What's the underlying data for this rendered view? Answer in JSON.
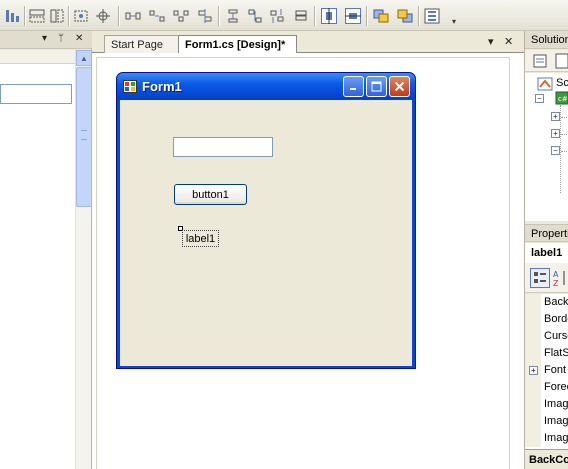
{
  "toolbar": {
    "buttons": [
      "align-to-grid-icon",
      "make-same-width-icon",
      "make-same-height-icon",
      "size-to-grid-icon",
      "center-icon",
      "horizontal-spacing-equal-icon",
      "increase-horizontal-spacing-icon",
      "decrease-horizontal-spacing-icon",
      "remove-horizontal-spacing-icon",
      "vertical-spacing-equal-icon",
      "increase-vertical-spacing-icon",
      "decrease-vertical-spacing-icon",
      "remove-vertical-spacing-icon",
      "center-horizontally-icon",
      "center-vertically-icon",
      "bring-to-front-icon",
      "send-to-back-icon",
      "tab-order-icon"
    ],
    "overflow_glyph": "▾"
  },
  "left_pane": {
    "pin_glyph": "▾",
    "autohide_glyph": "ᛘ",
    "close_glyph": "✕",
    "scroll_up_glyph": "▲"
  },
  "document_tabs": {
    "tabs": [
      {
        "label": "Start Page"
      },
      {
        "label": "Form1.cs [Design]*"
      }
    ],
    "dropdown_glyph": "▾",
    "close_glyph": "✕"
  },
  "form": {
    "title": "Form1",
    "button_label": "button1",
    "label_text": "label1",
    "textbox_value": "",
    "colors": {
      "titlebar": "#0B5AE8",
      "client": "#ECE9D8",
      "close_button": "#C33B12"
    }
  },
  "solution_explorer": {
    "title": "Solution",
    "tree": [
      {
        "text": "Sc",
        "expander": ""
      },
      {
        "text": "",
        "expander": "−"
      },
      {
        "text": "",
        "expander": "+"
      },
      {
        "text": "",
        "expander": "+"
      },
      {
        "text": "",
        "expander": "−"
      }
    ]
  },
  "properties": {
    "title": "Properti",
    "object": "label1",
    "rows": [
      {
        "name": "Backc",
        "expander": ""
      },
      {
        "name": "Borde",
        "expander": ""
      },
      {
        "name": "Curso",
        "expander": ""
      },
      {
        "name": "FlatS",
        "expander": ""
      },
      {
        "name": "Font",
        "expander": "+"
      },
      {
        "name": "Forec",
        "expander": ""
      },
      {
        "name": "Imag",
        "expander": ""
      },
      {
        "name": "Imag",
        "expander": ""
      },
      {
        "name": "Imag",
        "expander": ""
      }
    ],
    "footer": "BackCo"
  }
}
